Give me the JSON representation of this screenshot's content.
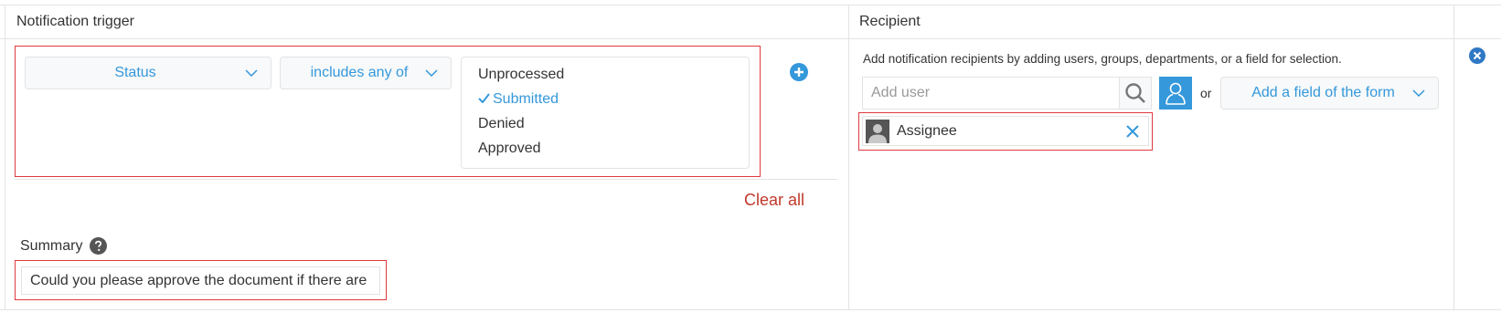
{
  "headers": {
    "trigger": "Notification trigger",
    "recipient": "Recipient"
  },
  "condition": {
    "field_label": "Status",
    "operator_label": "includes any of",
    "options": [
      {
        "label": "Unprocessed",
        "selected": false
      },
      {
        "label": "Submitted",
        "selected": true
      },
      {
        "label": "Denied",
        "selected": false
      },
      {
        "label": "Approved",
        "selected": false
      }
    ]
  },
  "clear_all_label": "Clear all",
  "summary": {
    "label": "Summary",
    "value": "Could you please approve the document if there are"
  },
  "recipient": {
    "hint": "Add notification recipients by adding users, groups, departments, or a field for selection.",
    "add_user_placeholder": "Add user",
    "or_label": "or",
    "add_field_label": "Add a field of the form",
    "chips": [
      {
        "label": "Assignee"
      }
    ]
  },
  "icons": {
    "add": "plus-circle-icon",
    "remove_row": "close-circle-icon",
    "search": "search-icon",
    "user_picker": "user-icon",
    "help": "question-circle-icon",
    "avatar": "avatar-icon",
    "chip_remove": "close-icon"
  },
  "colors": {
    "accent": "#3498db",
    "highlight_box": "#e0393e",
    "danger_text": "#c0392b"
  }
}
